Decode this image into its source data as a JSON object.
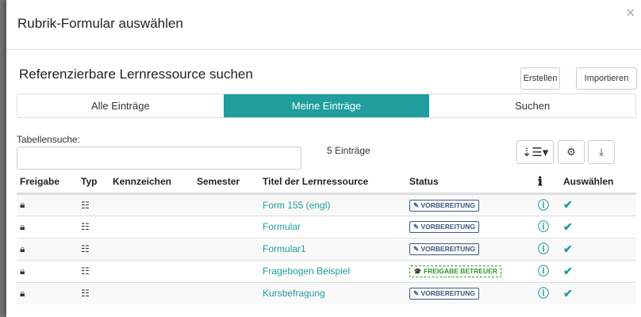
{
  "dialog": {
    "title": "Rubrik-Formular auswählen",
    "close_label": "×"
  },
  "section": {
    "heading": "Referenzierbare Lernressource suchen",
    "create_label": "Erstellen",
    "import_label": "Importieren"
  },
  "tabs": [
    {
      "label": "Alle Einträge"
    },
    {
      "label": "Meine Einträge",
      "active": true
    },
    {
      "label": "Suchen"
    }
  ],
  "search": {
    "label": "Tabellensuche:",
    "value": "",
    "count": "5 Einträge"
  },
  "columns": [
    "Freigabe",
    "Typ",
    "Kennzeichen",
    "Semester",
    "Titel der Lernressource",
    "Status",
    "ℹ",
    "Auswählen"
  ],
  "rows": [
    {
      "title": "Form 155 (engl)",
      "status": "VORBEREITUNG",
      "status_icon": "✎"
    },
    {
      "title": "Formular",
      "status": "VORBEREITUNG",
      "status_icon": "✎"
    },
    {
      "title": "Formular1",
      "status": "VORBEREITUNG",
      "status_icon": "✎"
    },
    {
      "title": "Fragebogen Beispiel",
      "status": "FREIGABE BETREUER",
      "status_icon": "🎓"
    },
    {
      "title": "Kursbefragung",
      "status": "VORBEREITUNG",
      "status_icon": "✎"
    }
  ],
  "colors": {
    "accent": "#209d9d",
    "status_prep": "#3e5c80",
    "status_released": "#2a9a2a"
  }
}
